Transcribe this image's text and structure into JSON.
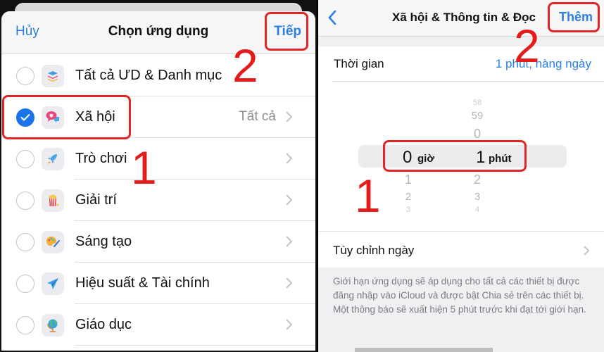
{
  "left_screen": {
    "nav": {
      "cancel_label": "Hủy",
      "title": "Chọn ứng dụng",
      "next_label": "Tiếp"
    },
    "categories": [
      {
        "label": "Tất cả ƯD & Danh mục",
        "icon": "stack-layers-icon",
        "checked": false,
        "detail": "",
        "has_chevron": false
      },
      {
        "label": "Xã hội",
        "icon": "chat-bubbles-heart-icon",
        "checked": true,
        "detail": "Tất cả",
        "has_chevron": true
      },
      {
        "label": "Trò chơi",
        "icon": "rocket-icon",
        "checked": false,
        "detail": "",
        "has_chevron": true
      },
      {
        "label": "Giải trí",
        "icon": "popcorn-icon",
        "checked": false,
        "detail": "",
        "has_chevron": true
      },
      {
        "label": "Sáng tạo",
        "icon": "palette-icon",
        "checked": false,
        "detail": "",
        "has_chevron": true
      },
      {
        "label": "Hiệu suất & Tài chính",
        "icon": "paper-plane-icon",
        "checked": false,
        "detail": "",
        "has_chevron": true
      },
      {
        "label": "Giáo dục",
        "icon": "globe-icon",
        "checked": false,
        "detail": "",
        "has_chevron": true
      }
    ],
    "annotations": {
      "step1": "1",
      "step2": "2"
    }
  },
  "right_screen": {
    "nav": {
      "back_icon": "chevron-left-icon",
      "title": "Xã hội & Thông tin & Đọc",
      "add_label": "Thêm"
    },
    "time_row": {
      "label": "Thời gian",
      "value": "1 phut, hàng ngày"
    },
    "picker": {
      "hours_above": [],
      "hours_selected": "0",
      "hours_unit": "giờ",
      "hours_below": [
        "1",
        "2",
        "3"
      ],
      "minutes_above": [
        "58",
        "59",
        "0"
      ],
      "minutes_selected": "1",
      "minutes_unit": "phút",
      "minutes_below": [
        "2",
        "3",
        "4"
      ]
    },
    "custom_days_label": "Tùy chỉnh ngày",
    "footer_note": "Giới hạn ứng dụng sẽ áp dụng cho tất cả các thiết bị được đăng nhập vào iCloud và được bật Chia sẻ trên các thiết bị. Một thông báo sẽ xuất hiện 5 phút trước khi đạt tới giới hạn.",
    "annotations": {
      "step1": "1",
      "step2": "2"
    }
  },
  "colors": {
    "accent": "#2b7fe0",
    "annotation": "#e02626",
    "check": "#1a73e8"
  }
}
